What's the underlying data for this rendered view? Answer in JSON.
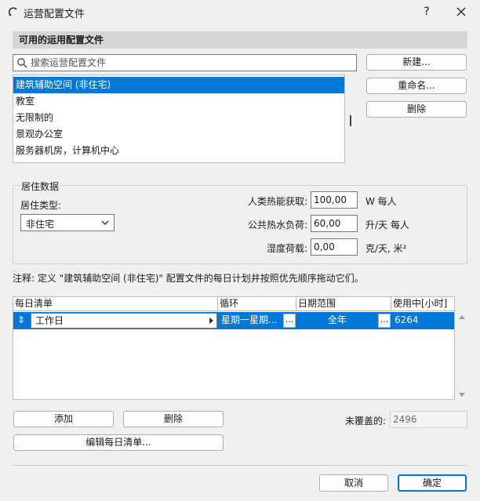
{
  "window": {
    "title": "运营配置文件",
    "help": "?"
  },
  "profiles": {
    "header": "可用的运用配置文件",
    "search_placeholder": "搜索运营配置文件",
    "items": [
      {
        "label": "建筑辅助空间 (非住宅)",
        "selected": true
      },
      {
        "label": "教室",
        "selected": false
      },
      {
        "label": "无限制的",
        "selected": false
      },
      {
        "label": "景观办公室",
        "selected": false
      },
      {
        "label": "服务器机房，计算机中心",
        "selected": false
      }
    ],
    "buttons": {
      "new": "新建...",
      "rename": "重命名...",
      "delete": "删除"
    }
  },
  "occupancy": {
    "group_title": "居住数据",
    "type_label": "居住类型:",
    "type_value": "非住宅",
    "human_heat_label": "人类热能获取:",
    "human_heat_value": "100,00",
    "human_heat_unit": "W 每人",
    "hot_water_label": "公共热水负荷:",
    "hot_water_value": "60,00",
    "hot_water_unit": "升/天 每人",
    "humidity_label": "湿度荷载:",
    "humidity_value": "0,00",
    "humidity_unit": "克/天, 米²"
  },
  "note": "注释: 定义 \"建筑辅助空间 (非住宅)\" 配置文件的每日计划并按照优先顺序拖动它们。",
  "schedule": {
    "columns": [
      "每日清单",
      "循环",
      "日期范围",
      "使用中[小时]"
    ],
    "rows": [
      {
        "name": "工作日",
        "cycle": "星期一星期...",
        "range": "全年",
        "hours": "6264"
      }
    ],
    "dots": "...",
    "sort_glyph": "⇕"
  },
  "actions": {
    "add": "添加",
    "delete": "删除",
    "edit_daily": "编辑每日清单...",
    "uncovered_label": "未覆盖的:",
    "uncovered_value": "2496"
  },
  "footer": {
    "cancel": "取消",
    "ok": "确定"
  },
  "colors": {
    "selection": "#0078d7",
    "background": "#f0f0f0"
  }
}
